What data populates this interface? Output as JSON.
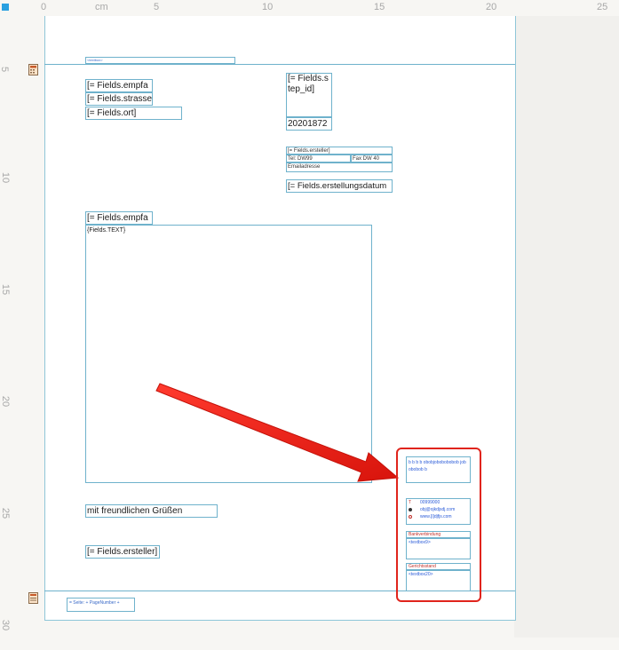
{
  "ruler": {
    "unit": "cm",
    "top_labels": [
      "0",
      "cm",
      "5",
      "10",
      "15",
      "20",
      "25"
    ],
    "left_labels": [
      "5",
      "10",
      "15",
      "20",
      "25",
      "30"
    ]
  },
  "header": {
    "textbox": "<textbox>"
  },
  "address": {
    "empfa": "[= Fields.empfa",
    "strasse": "[= Fields.strasse",
    "ort": "[= Fields.ort]"
  },
  "step": {
    "field": "[= Fields.step_id]",
    "number": "20201872"
  },
  "contact": {
    "ersteller": "[= Fields.ersteller]",
    "tel": "Tel: DW99",
    "fax": "Fax DW 40",
    "email": "Emailadresse",
    "erstellungsdatum": "[= Fields.erstellungsdatum"
  },
  "body": {
    "empfa": "[= Fields.empfa",
    "text": "{Fields.TEXT}",
    "greeting": "mit freundlichen Grüßen",
    "ersteller": "[= Fields.ersteller]"
  },
  "sidebar": {
    "header_text": "b b b b obobjobobobobob jobobobob b",
    "phone": "00999000",
    "email": "obj@ojkdjsdj.com",
    "web": "www.[i]djfjs.com",
    "bank_label": "Bankverbindung",
    "bank_box": "<textbox9>",
    "court_label": "Gerichtsstand",
    "court_box": "<textbox20>"
  },
  "footer": {
    "page": "= Seite: + PageNumber +"
  },
  "colors": {
    "guide": "#6fb2cc",
    "annotation": "#e0241c"
  },
  "icons": {
    "header_section": "calculator-icon",
    "footer_section": "page-icon"
  }
}
